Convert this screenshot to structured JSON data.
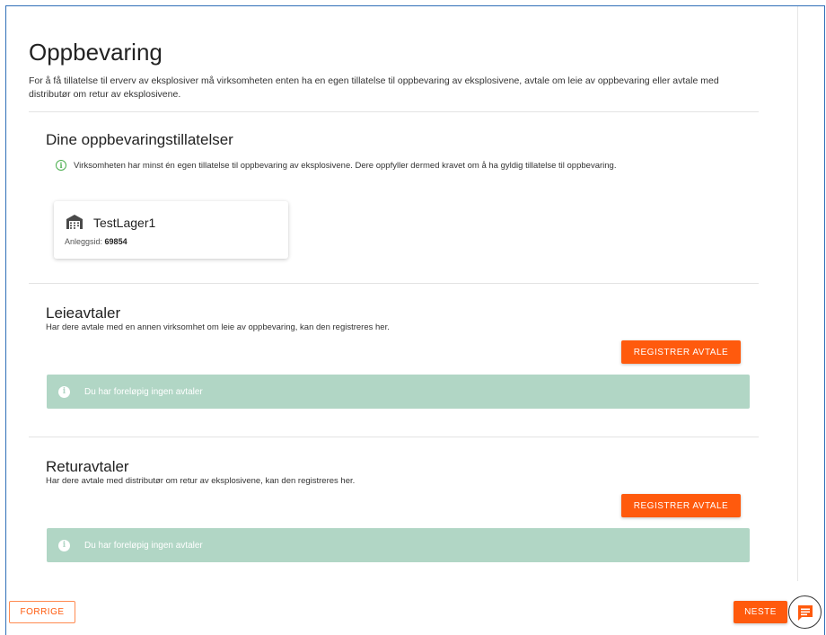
{
  "page": {
    "title": "Oppbevaring",
    "intro": "For å få tillatelse til erverv av eksplosiver må virksomheten enten ha en egen tillatelse til oppbevaring av eksplosivene, avtale om leie av oppbevaring eller avtale med distributør om retur av eksplosivene."
  },
  "permits": {
    "title": "Dine oppbevaringstillatelser",
    "info": "Virksomheten har minst én egen tillatelse til oppbevaring av eksplosivene. Dere oppfyller dermed kravet om å ha gyldig tillatelse til oppbevaring.",
    "info_icon": "i",
    "cards": [
      {
        "name": "TestLager1",
        "id_label": "Anleggsid:",
        "id_value": "69854",
        "icon": "warehouse-icon"
      }
    ]
  },
  "lease": {
    "title": "Leieavtaler",
    "subtitle": "Har dere avtale med en annen virksomhet om leie av oppbevaring, kan den registreres her.",
    "register_label": "REGISTRER AVTALE",
    "empty_icon": "i",
    "empty_text": "Du har foreløpig ingen avtaler"
  },
  "returns": {
    "title": "Returavtaler",
    "subtitle": "Har dere avtale med distributør om retur av eksplosivene, kan den registreres her.",
    "register_label": "REGISTRER AVTALE",
    "empty_icon": "i",
    "empty_text": "Du har foreløpig ingen avtaler"
  },
  "nav": {
    "prev_label": "FORRIGE",
    "next_label": "NESTE"
  },
  "colors": {
    "accent": "#ff5a0d",
    "notice_bg": "#b1d6c5",
    "success": "#4caf50"
  }
}
